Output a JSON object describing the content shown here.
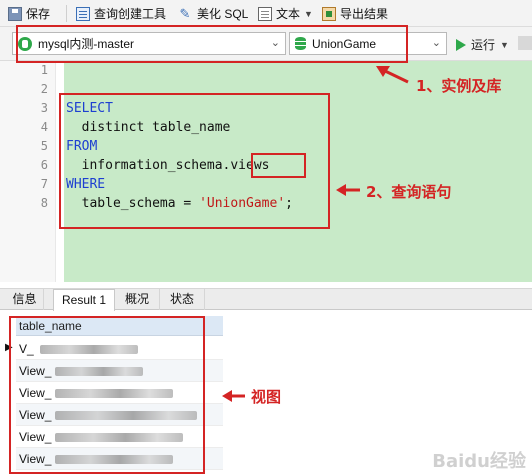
{
  "toolbar": {
    "save": "保存",
    "query_builder": "查询创建工具",
    "beautify": "美化 SQL",
    "text": "文本",
    "export": "导出结果"
  },
  "connection": {
    "server": "mysql内测-master",
    "database": "UnionGame",
    "run": "运行"
  },
  "editor": {
    "line_numbers": [
      "1",
      "2",
      "3",
      "4",
      "5",
      "6",
      "7",
      "8"
    ],
    "lines": [
      {
        "kw": "",
        "text": ""
      },
      {
        "kw": "",
        "text": ""
      },
      {
        "kw": "SELECT",
        "text": ""
      },
      {
        "kw": "",
        "text": "  distinct table_name"
      },
      {
        "kw": "FROM",
        "text": ""
      },
      {
        "kw": "",
        "text": "  information_schema.views"
      },
      {
        "kw": "WHERE",
        "text": ""
      },
      {
        "kw": "",
        "text": "  table_schema = ",
        "str": "'UnionGame'",
        "tail": ";"
      }
    ]
  },
  "tabs": [
    "信息",
    "Result 1",
    "概况",
    "状态"
  ],
  "grid": {
    "header": "table_name",
    "rows": [
      "V_",
      "View_",
      "View_",
      "View_",
      "View_",
      "View_"
    ]
  },
  "annotations": {
    "a1": "1、实例及库",
    "a2": "2、查询语句",
    "a3": "视图"
  },
  "colors": {
    "annotation": "#d42424",
    "keyword": "#1d3fd1",
    "string": "#c01818",
    "editor_bg": "#c8eac8"
  },
  "watermark": "Baidu经验"
}
